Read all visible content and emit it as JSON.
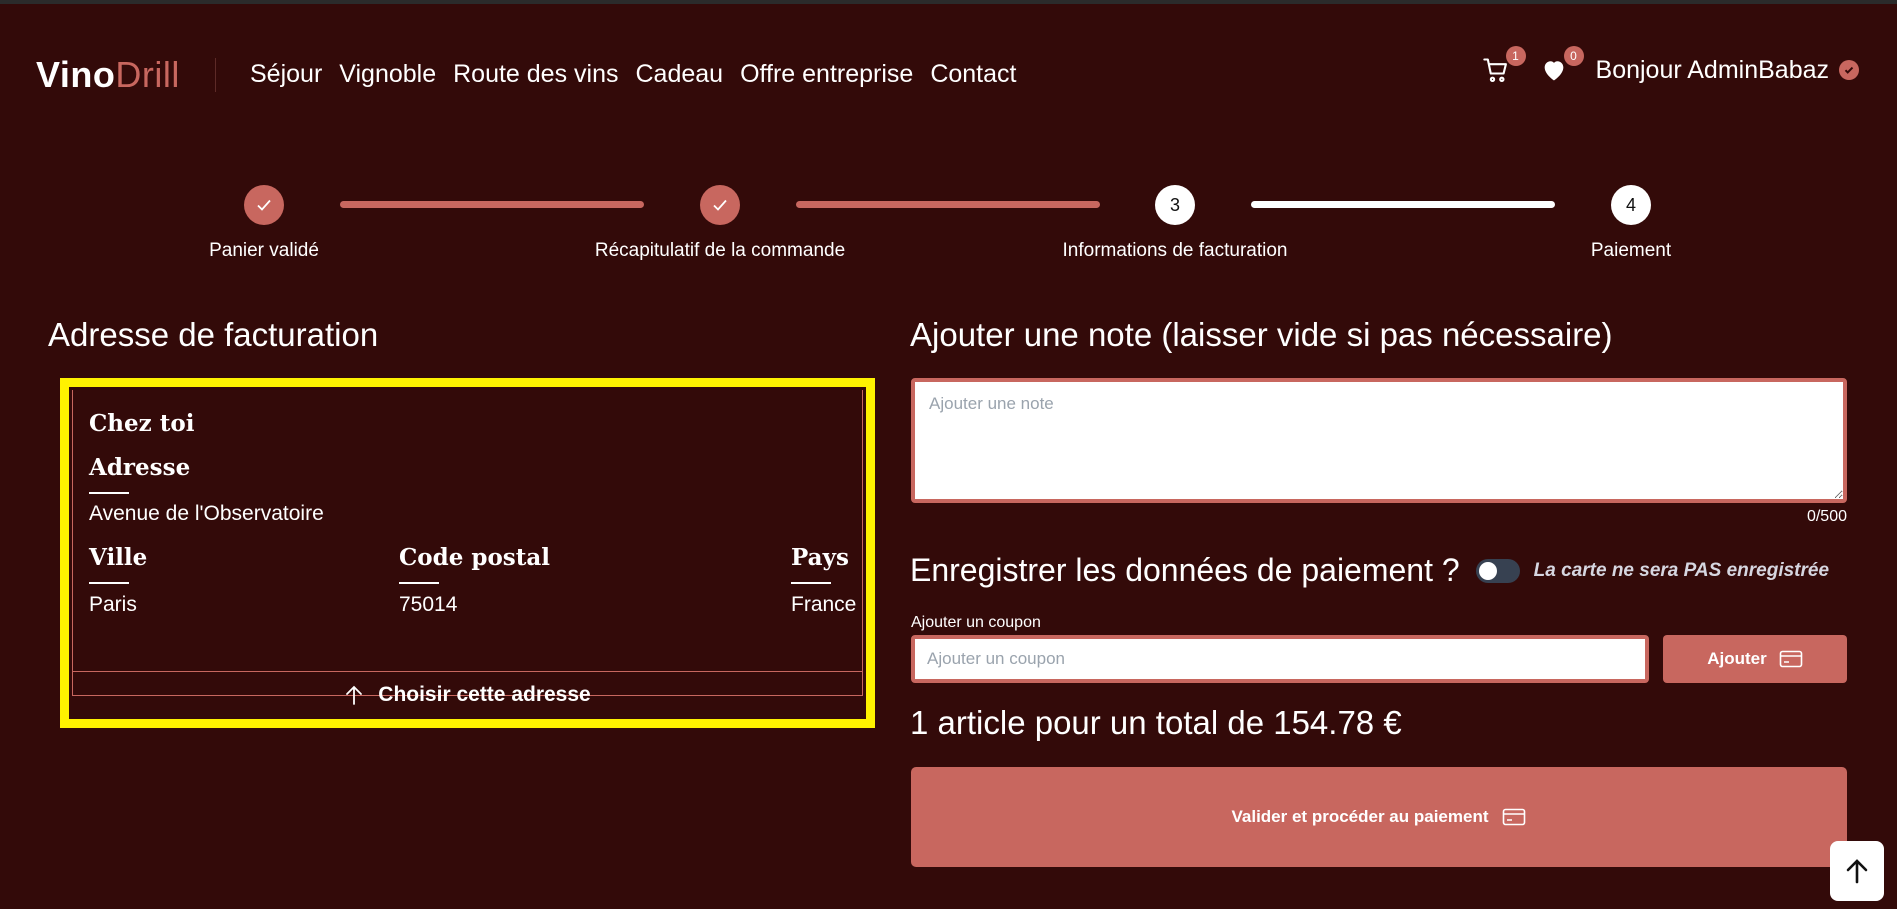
{
  "header": {
    "logo_part1": "Vino",
    "logo_part2": "Drill",
    "nav": [
      "Séjour",
      "Vignoble",
      "Route des vins",
      "Cadeau",
      "Offre entreprise",
      "Contact"
    ],
    "cart_count": "1",
    "wishlist_count": "0",
    "greeting": "Bonjour AdminBabaz",
    "icons": {
      "cart": "cart-icon",
      "wishlist": "heart-icon",
      "verified": "verified-icon"
    }
  },
  "stepper": {
    "steps": [
      {
        "label": "Panier validé",
        "status": "done",
        "marker": ""
      },
      {
        "label": "Récapitulatif de la commande",
        "status": "done",
        "marker": ""
      },
      {
        "label": "Informations de facturation",
        "status": "current",
        "marker": "3"
      },
      {
        "label": "Paiement",
        "status": "todo",
        "marker": "4"
      }
    ]
  },
  "billing": {
    "heading": "Adresse de facturation",
    "address_name": "Chez toi",
    "address_title": "Adresse",
    "address_value": "Avenue de l'Observatoire",
    "city_title": "Ville",
    "city_value": "Paris",
    "postal_title": "Code postal",
    "postal_value": "75014",
    "country_title": "Pays",
    "country_value": "France",
    "choose_label": "Choisir cette adresse"
  },
  "note": {
    "heading": "Ajouter une note (laisser vide si pas nécessaire)",
    "placeholder": "Ajouter une note",
    "value": "",
    "counter": "0/500"
  },
  "payment_save": {
    "label": "Enregistrer les données de paiement ?",
    "toggle_on": false,
    "note": "La carte ne sera PAS enregistrée"
  },
  "coupon": {
    "label": "Ajouter un coupon",
    "placeholder": "Ajouter un coupon",
    "button_label": "Ajouter"
  },
  "summary": {
    "total_text": "1 article pour un total de 154.78 €",
    "pay_button": "Valider et procéder au paiement"
  },
  "colors": {
    "background": "#330a09",
    "accent": "#c8675f",
    "highlight_border": "#fff200"
  }
}
